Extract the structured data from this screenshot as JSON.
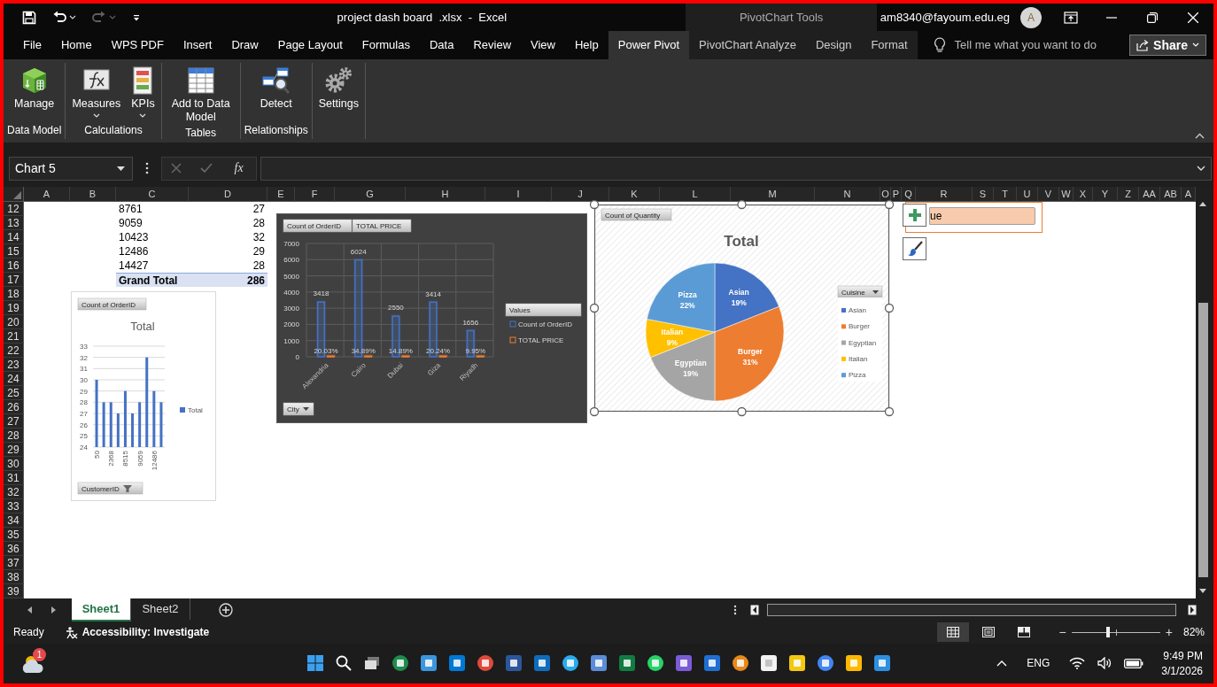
{
  "window": {
    "title": "project dash board  .xlsx  -  Excel",
    "context_title": "PivotChart Tools",
    "account": "am8340@fayoum.edu.eg",
    "avatar": "A"
  },
  "quick_access": [
    {
      "kind": "save",
      "disabled": false
    },
    {
      "kind": "undo",
      "disabled": false
    },
    {
      "kind": "redo",
      "disabled": true
    },
    {
      "kind": "customize",
      "disabled": false
    }
  ],
  "tabs": [
    {
      "label": "File",
      "selected": false,
      "contextual": false
    },
    {
      "label": "Home",
      "selected": false,
      "contextual": false
    },
    {
      "label": "WPS PDF",
      "selected": false,
      "contextual": false
    },
    {
      "label": "Insert",
      "selected": false,
      "contextual": false
    },
    {
      "label": "Draw",
      "selected": false,
      "contextual": false
    },
    {
      "label": "Page Layout",
      "selected": false,
      "contextual": false
    },
    {
      "label": "Formulas",
      "selected": false,
      "contextual": false
    },
    {
      "label": "Data",
      "selected": false,
      "contextual": false
    },
    {
      "label": "Review",
      "selected": false,
      "contextual": false
    },
    {
      "label": "View",
      "selected": false,
      "contextual": false
    },
    {
      "label": "Help",
      "selected": false,
      "contextual": false
    },
    {
      "label": "Power Pivot",
      "selected": true,
      "contextual": false
    },
    {
      "label": "PivotChart Analyze",
      "selected": false,
      "contextual": true
    },
    {
      "label": "Design",
      "selected": false,
      "contextual": true
    },
    {
      "label": "Format",
      "selected": false,
      "contextual": true
    }
  ],
  "tell_me": "Tell me what you want to do",
  "share": "Share",
  "ribbon": [
    {
      "label": "Data Model",
      "buttons": [
        {
          "kind": "manage",
          "label": "Manage",
          "dropdown": false
        }
      ]
    },
    {
      "label": "Calculations",
      "buttons": [
        {
          "kind": "measures",
          "label": "Measures",
          "dropdown": true
        },
        {
          "kind": "kpis",
          "label": "KPIs",
          "dropdown": true
        }
      ]
    },
    {
      "label": "Tables",
      "buttons": [
        {
          "kind": "table",
          "label": "Add to Data Model",
          "dropdown": false
        }
      ]
    },
    {
      "label": "Relationships",
      "buttons": [
        {
          "kind": "detect",
          "label": "Detect",
          "dropdown": false
        }
      ]
    },
    {
      "buttons": [
        {
          "kind": "settings",
          "label": "Settings",
          "dropdown": false
        }
      ]
    }
  ],
  "formula_bar": {
    "name_box": "Chart 5",
    "function_button": "fx"
  },
  "sheet": {
    "columns": [
      "A",
      "B",
      "C",
      "D",
      "E",
      "F",
      "G",
      "H",
      "I",
      "J",
      "K",
      "L",
      "M",
      "N",
      "O",
      "P",
      "Q",
      "R",
      "S",
      "T",
      "U",
      "V",
      "W",
      "X",
      "Y",
      "Z",
      "AA",
      "AB",
      "A"
    ],
    "rows": [
      "12",
      "13",
      "14",
      "15",
      "16",
      "17",
      "18",
      "19",
      "20",
      "21",
      "22",
      "23",
      "24",
      "25",
      "26",
      "27",
      "28",
      "29",
      "30",
      "31",
      "32",
      "33",
      "34",
      "35",
      "36",
      "37",
      "38",
      "39"
    ],
    "pivot": [
      {
        "label": "8761",
        "value": "27"
      },
      {
        "label": "9059",
        "value": "28"
      },
      {
        "label": "10423",
        "value": "32"
      },
      {
        "label": "12486",
        "value": "29"
      },
      {
        "label": "14427",
        "value": "28"
      }
    ],
    "grand_total": {
      "label": "Grand Total",
      "value": "286"
    }
  },
  "charts": [
    {
      "field_buttons": [
        "Count of OrderID"
      ],
      "axis_button": "CustomerID",
      "selected": false,
      "chart_data": {
        "type": "bar",
        "title": "Total",
        "grid": true,
        "legend": "right",
        "categories": [
          "50",
          null,
          "2368",
          null,
          "8515",
          null,
          "9059",
          null,
          "12486",
          null
        ],
        "series": [
          {
            "name": "Total",
            "color": "#4472c4",
            "values": [
              30,
              28,
              28,
              27,
              29,
              27,
              28,
              32,
              29,
              28
            ]
          }
        ],
        "ylim": [
          24,
          33
        ],
        "yticks": [
          24,
          25,
          26,
          27,
          28,
          29,
          30,
          31,
          32,
          33
        ]
      }
    },
    {
      "field_buttons": [
        "Count of OrderID",
        "TOTAL PRICE"
      ],
      "legend_title": "Values",
      "axis_button": "City",
      "selected": false,
      "chart_data": {
        "type": "bar",
        "grid": true,
        "legend": "right",
        "categories": [
          "Alexandria",
          "Cairo",
          "Dubai",
          "Giza",
          "Riyadh"
        ],
        "series": [
          {
            "name": "Count of OrderID",
            "color": "#4472c4",
            "values": [
              3418,
              6024,
              2550,
              3414,
              1656
            ]
          },
          {
            "name": "TOTAL PRICE",
            "color": "#ed7d31",
            "values": [
              0,
              0,
              0,
              0,
              0
            ]
          }
        ],
        "ylim": [
          0,
          7000
        ],
        "yticks": [
          0,
          1000,
          2000,
          3000,
          4000,
          5000,
          6000,
          7000
        ],
        "value_labels": [
          [
            "3418",
            "6024",
            "2550",
            "3414",
            "1656"
          ],
          [
            "20.03%",
            "34.89%",
            "14.89%",
            "20.24%",
            "9.95%"
          ]
        ]
      }
    },
    {
      "field_buttons": [
        "Count of Quantity"
      ],
      "legend_title": "Cuisine",
      "selected": true,
      "chart_data": {
        "type": "pie",
        "title": "Total",
        "legend": "right",
        "categories": [
          "Asian",
          "Burger",
          "Egyptian",
          "Italian",
          "Pizza"
        ],
        "series": [
          {
            "values": [
              19,
              31,
              19,
              9,
              22
            ]
          }
        ],
        "colors": [
          "#4472c4",
          "#ed7d31",
          "#a5a5a5",
          "#ffc000",
          "#5b9bd5"
        ],
        "value_labels": [
          "19%",
          "31%",
          "19%",
          "9%",
          "22%"
        ]
      }
    }
  ],
  "chart_tools": {
    "field_text": "ue"
  },
  "sheet_tabs": [
    {
      "label": "Sheet1",
      "selected": true
    },
    {
      "label": "Sheet2",
      "selected": false
    }
  ],
  "status_bar": {
    "status": "Ready",
    "accessibility": "Accessibility: Investigate",
    "views": [
      {
        "kind": "normal",
        "selected": true
      },
      {
        "kind": "page_layout",
        "selected": false
      },
      {
        "kind": "page_break",
        "selected": false
      }
    ],
    "zoom_out": "−",
    "zoom_in": "+",
    "zoom": {
      "level": 0.41
    },
    "zoom_reading": "82%"
  },
  "taskbar": {
    "notification_badge": "1",
    "language": "ENG",
    "time": "9:49 PM",
    "date": "3/1/2026"
  }
}
